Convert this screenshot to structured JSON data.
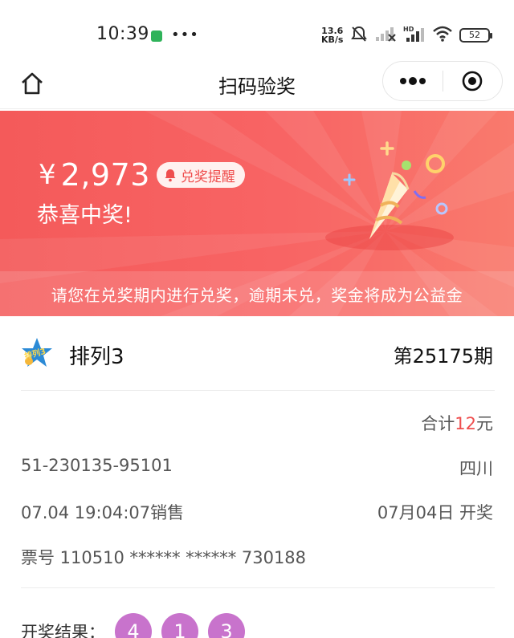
{
  "status_bar": {
    "time": "10:39",
    "net_speed_value": "13.6",
    "net_speed_unit": "KB/s",
    "battery": "52",
    "icons": [
      "wechat-icon",
      "mute-icon",
      "signal-icon",
      "hd-signal-icon",
      "wifi-icon",
      "battery-icon"
    ]
  },
  "title_bar": {
    "title": "扫码验奖",
    "icons": [
      "home-icon",
      "more-icon",
      "close-target-icon"
    ]
  },
  "banner": {
    "currency": "¥",
    "prize_amount": "2,973",
    "remind_label": "兑奖提醒",
    "congrats": "恭喜中奖!",
    "notice": "请您在兑奖期内进行兑奖，逾期未兑，奖金将成为公益金",
    "colors": {
      "background": "#f45a5a",
      "accent": "#ef4e4e"
    }
  },
  "ticket": {
    "game_name": "排列3",
    "game_logo_text": "排列3",
    "issue": "第25175期",
    "total_prefix": "合计",
    "total_amount": "12",
    "total_suffix": "元",
    "ticket_code": "51-230135-95101",
    "region": "四川",
    "sale_time": "07.04 19:04:07销售",
    "draw_date": "07月04日 开奖",
    "ticket_number": "票号 110510 ****** ****** 730188"
  },
  "result": {
    "label": "开奖结果：",
    "numbers": [
      "4",
      "1",
      "3"
    ],
    "ball_color": "#c873cc"
  }
}
